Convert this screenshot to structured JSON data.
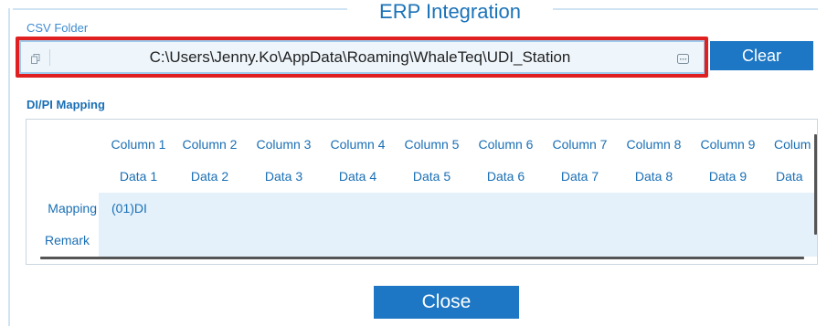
{
  "window": {
    "title": "ERP Integration"
  },
  "csv": {
    "label": "CSV Folder",
    "path": "C:\\Users\\Jenny.Ko\\AppData\\Roaming\\WhaleTeq\\UDI_Station",
    "clear_label": "Clear"
  },
  "mapping": {
    "label": "DI/PI Mapping",
    "columns": [
      "Column 1",
      "Column 2",
      "Column 3",
      "Column 4",
      "Column 5",
      "Column 6",
      "Column 7",
      "Column 8",
      "Column 9",
      "Colum"
    ],
    "data": [
      "Data 1",
      "Data 2",
      "Data 3",
      "Data 4",
      "Data 5",
      "Data 6",
      "Data 7",
      "Data 8",
      "Data 9",
      "Data"
    ],
    "mapping_label": "Mapping",
    "mapping_values": [
      "(01)DI",
      "",
      "",
      "",
      "",
      "",
      "",
      "",
      "",
      ""
    ],
    "remark_label": "Remark"
  },
  "footer": {
    "close_label": "Close"
  },
  "colors": {
    "accent": "#1d77c4",
    "highlight": "#e02020",
    "cell_shade": "#e4f1fb"
  }
}
